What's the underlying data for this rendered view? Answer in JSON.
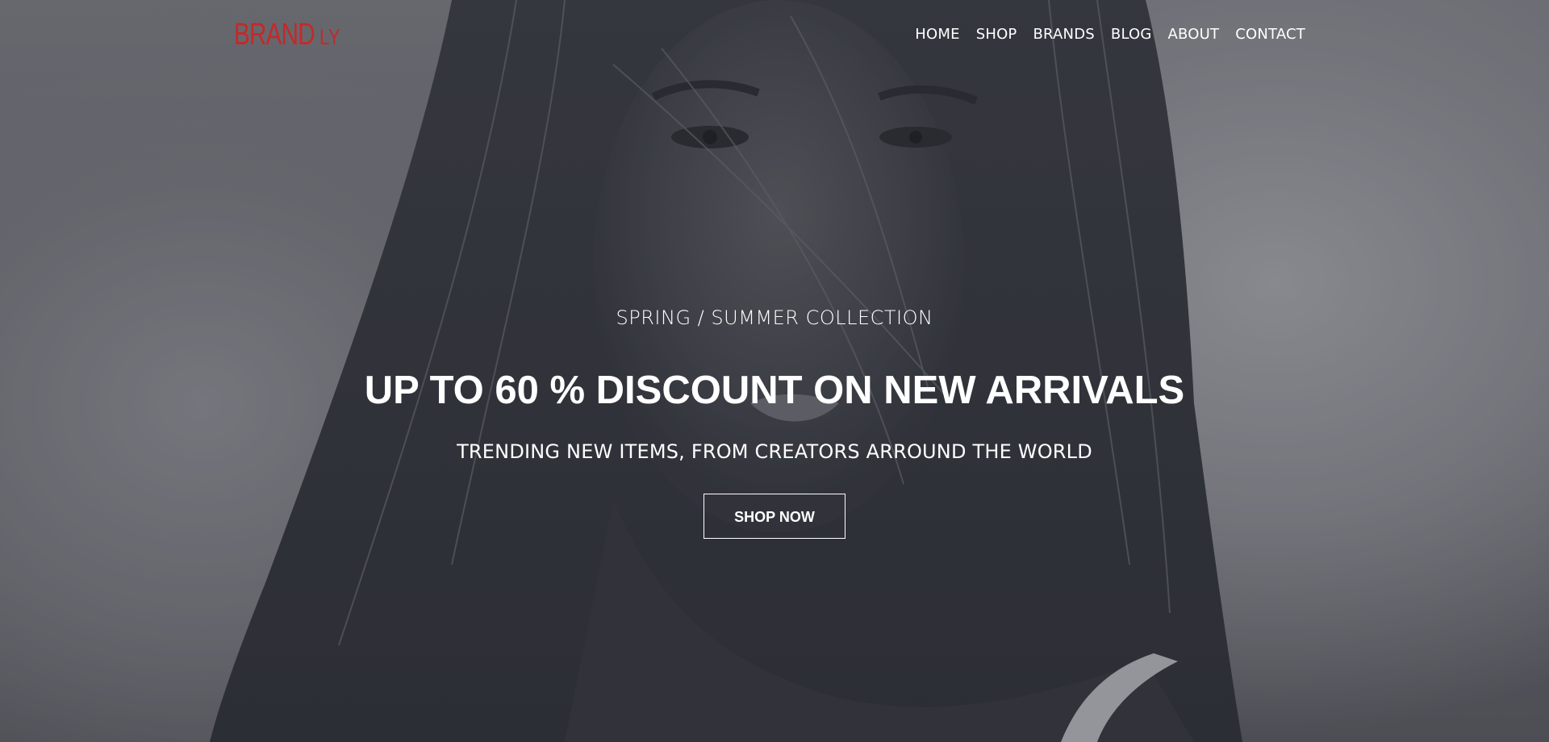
{
  "header": {
    "logo_main": "BRAND",
    "logo_suffix": "LY",
    "nav": [
      {
        "label": "HOME"
      },
      {
        "label": "SHOP"
      },
      {
        "label": "BRANDS"
      },
      {
        "label": "BLOG"
      },
      {
        "label": "ABOUT"
      },
      {
        "label": "CONTACT"
      }
    ]
  },
  "hero": {
    "collection_label": "SPRING / SUMMER COLLECTION",
    "headline": "UP TO 60 % DISCOUNT ON NEW ARRIVALS",
    "subheadline": "TRENDING NEW ITEMS, FROM CREATORS ARROUND THE WORLD",
    "button_label": "SHOP NOW"
  },
  "colors": {
    "brand": "#c62828",
    "text": "#ffffff"
  }
}
